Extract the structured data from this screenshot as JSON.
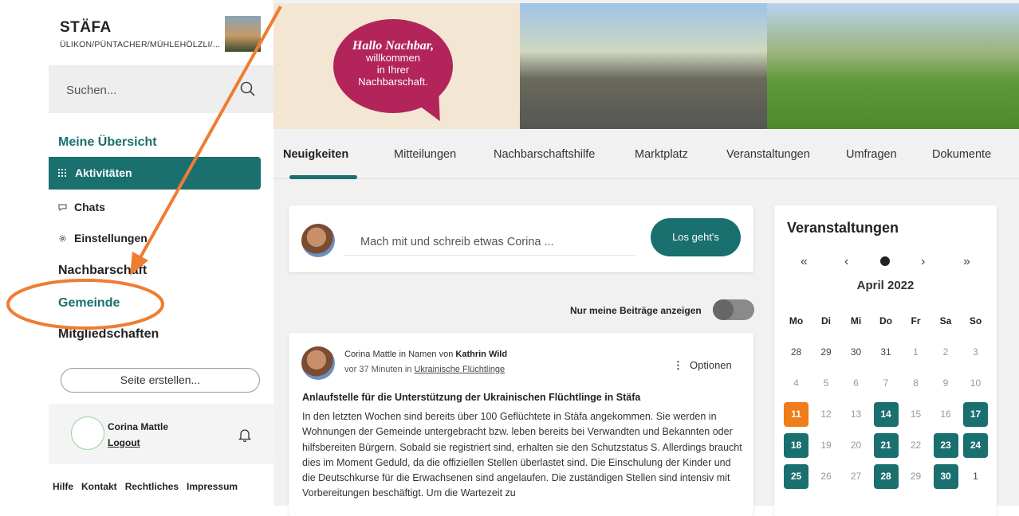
{
  "sidebar": {
    "org_title": "STÄFA",
    "org_subtitle": "ÜLIKON/PÜNTACHER/MÜHLEHÖLZLI/...",
    "search_placeholder": "Suchen...",
    "section_overview": "Meine Übersicht",
    "items": [
      {
        "label": "Aktivitäten",
        "icon": "grid-icon"
      },
      {
        "label": "Chats",
        "icon": "chat-bubble-icon"
      },
      {
        "label": "Einstellungen",
        "icon": "gear-icon"
      }
    ],
    "section_neighborhood": "Nachbarschaft",
    "section_community": "Gemeinde",
    "section_memberships": "Mitgliedschaften",
    "create_page": "Seite erstellen...",
    "user_name": "Corina Mattle",
    "logout": "Logout",
    "footer": [
      "Hilfe",
      "Kontakt",
      "Rechtliches",
      "Impressum"
    ]
  },
  "banner": {
    "line1": "Hallo Nachbar,",
    "line2": "willkommen",
    "line3": "in Ihrer",
    "line4": "Nachbarschaft."
  },
  "tabs": [
    "Neuigkeiten",
    "Mitteilungen",
    "Nachbarschaftshilfe",
    "Marktplatz",
    "Veranstaltungen",
    "Umfragen",
    "Dokumente"
  ],
  "composer": {
    "placeholder": "Mach mit und schreib etwas Corina ...",
    "button": "Los geht's"
  },
  "toggle_label": "Nur meine Beiträge anzeigen",
  "post": {
    "author_prefix": "Corina Mattle in Namen von",
    "author_name": "Kathrin Wild",
    "meta_prefix": "vor 37 Minuten in",
    "meta_group": "Ukrainische Flüchtlinge",
    "options": "Optionen",
    "title": "Anlaufstelle für die Unterstützung der Ukrainischen Flüchtlinge in Stäfa",
    "body": "In den letzten Wochen sind bereits über 100 Geflüchtete in Stäfa angekommen. Sie werden in Wohnungen der Gemeinde untergebracht bzw. leben bereits bei Verwandten und Bekannten oder hilfsbereiten Bürgern. Sobald sie registriert sind, erhalten sie den Schutzstatus S. Allerdings braucht dies im Moment Geduld, da die offiziellen Stellen überlastet sind. Die Einschulung der Kinder und die Deutschkurse für die Erwachsenen sind angelaufen. Die zuständigen Stellen sind intensiv mit Vorbereitungen beschäftigt. Um die Wartezeit zu"
  },
  "events": {
    "title": "Veranstaltungen",
    "nav": [
      "«",
      "‹",
      "›",
      "»"
    ],
    "month": "April 2022",
    "weekdays": [
      "Mo",
      "Di",
      "Mi",
      "Do",
      "Fr",
      "Sa",
      "So"
    ],
    "weeks": [
      [
        "28",
        "29",
        "30",
        "31",
        "1",
        "2",
        "3"
      ],
      [
        "4",
        "5",
        "6",
        "7",
        "8",
        "9",
        "10"
      ],
      [
        "11",
        "12",
        "13",
        "14",
        "15",
        "16",
        "17"
      ],
      [
        "18",
        "19",
        "20",
        "21",
        "22",
        "23",
        "24"
      ],
      [
        "25",
        "26",
        "27",
        "28",
        "29",
        "30",
        "1"
      ]
    ],
    "today": "11",
    "event_days": [
      "14",
      "17",
      "18",
      "21",
      "23",
      "24",
      "25",
      "28",
      "30"
    ]
  },
  "colors": {
    "accent": "#1a6f6f",
    "today": "#ef7d1a",
    "bubble": "#b2245a",
    "annotation": "#ee7d31"
  }
}
